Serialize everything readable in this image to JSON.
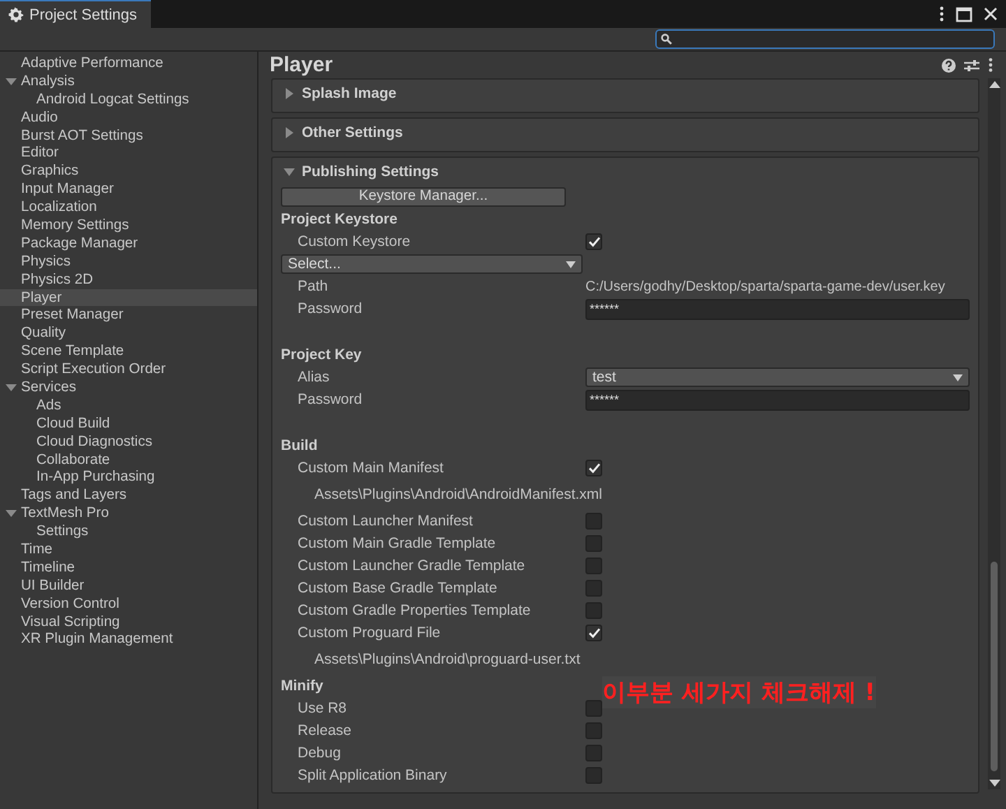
{
  "window": {
    "title": "Project Settings"
  },
  "sidebar": {
    "items": [
      {
        "label": "Adaptive Performance",
        "selected": false
      },
      {
        "label": "Analysis",
        "selected": false,
        "expanded": true,
        "children": [
          {
            "label": "Android Logcat Settings",
            "selected": false
          }
        ]
      },
      {
        "label": "Audio",
        "selected": false
      },
      {
        "label": "Burst AOT Settings",
        "selected": false
      },
      {
        "label": "Editor",
        "selected": false
      },
      {
        "label": "Graphics",
        "selected": false
      },
      {
        "label": "Input Manager",
        "selected": false
      },
      {
        "label": "Localization",
        "selected": false
      },
      {
        "label": "Memory Settings",
        "selected": false
      },
      {
        "label": "Package Manager",
        "selected": false
      },
      {
        "label": "Physics",
        "selected": false
      },
      {
        "label": "Physics 2D",
        "selected": false
      },
      {
        "label": "Player",
        "selected": true
      },
      {
        "label": "Preset Manager",
        "selected": false
      },
      {
        "label": "Quality",
        "selected": false
      },
      {
        "label": "Scene Template",
        "selected": false
      },
      {
        "label": "Script Execution Order",
        "selected": false
      },
      {
        "label": "Services",
        "selected": false,
        "expanded": true,
        "children": [
          {
            "label": "Ads",
            "selected": false
          },
          {
            "label": "Cloud Build",
            "selected": false
          },
          {
            "label": "Cloud Diagnostics",
            "selected": false
          },
          {
            "label": "Collaborate",
            "selected": false
          },
          {
            "label": "In-App Purchasing",
            "selected": false
          }
        ]
      },
      {
        "label": "Tags and Layers",
        "selected": false
      },
      {
        "label": "TextMesh Pro",
        "selected": false,
        "expanded": true,
        "children": [
          {
            "label": "Settings",
            "selected": false
          }
        ]
      },
      {
        "label": "Time",
        "selected": false
      },
      {
        "label": "Timeline",
        "selected": false
      },
      {
        "label": "UI Builder",
        "selected": false
      },
      {
        "label": "Version Control",
        "selected": false
      },
      {
        "label": "Visual Scripting",
        "selected": false
      },
      {
        "label": "XR Plugin Management",
        "selected": false
      }
    ]
  },
  "inspector": {
    "title": "Player",
    "sections": [
      {
        "title": "Splash Image",
        "expanded": false
      },
      {
        "title": "Other Settings",
        "expanded": false
      },
      {
        "title": "Publishing Settings",
        "expanded": true,
        "groups": [
          {
            "rows": [
              {
                "kind": "button",
                "label": "Keystore Manager..."
              },
              {
                "kind": "heading",
                "label": "Project Keystore"
              },
              {
                "kind": "checkbox",
                "label": "Custom Keystore",
                "checked": true
              },
              {
                "kind": "dropdown",
                "value": "Select..."
              },
              {
                "kind": "text",
                "label": "Path",
                "value": "C:/Users/godhy/Desktop/sparta/sparta-game-dev/user.key"
              },
              {
                "kind": "password",
                "label": "Password",
                "value": "******"
              }
            ]
          },
          {
            "rows": [
              {
                "kind": "heading",
                "label": "Project Key"
              },
              {
                "kind": "select",
                "label": "Alias",
                "value": "test"
              },
              {
                "kind": "password",
                "label": "Password",
                "value": "******"
              }
            ]
          },
          {
            "rows": [
              {
                "kind": "heading",
                "label": "Build"
              },
              {
                "kind": "checkbox",
                "label": "Custom Main Manifest",
                "checked": true
              },
              {
                "kind": "file",
                "value": "Assets\\Plugins\\Android\\AndroidManifest.xml"
              },
              {
                "kind": "checkbox",
                "label": "Custom Launcher Manifest",
                "checked": false
              },
              {
                "kind": "checkbox",
                "label": "Custom Main Gradle Template",
                "checked": false
              },
              {
                "kind": "checkbox",
                "label": "Custom Launcher Gradle Template",
                "checked": false
              },
              {
                "kind": "checkbox",
                "label": "Custom Base Gradle Template",
                "checked": false
              },
              {
                "kind": "checkbox",
                "label": "Custom Gradle Properties Template",
                "checked": false
              },
              {
                "kind": "checkbox",
                "label": "Custom Proguard File",
                "checked": true
              },
              {
                "kind": "file",
                "value": "Assets\\Plugins\\Android\\proguard-user.txt"
              },
              {
                "kind": "heading",
                "label": "Minify"
              },
              {
                "kind": "checkbox",
                "label": "Use R8",
                "checked": false
              },
              {
                "kind": "checkbox",
                "label": "Release",
                "checked": false
              },
              {
                "kind": "checkbox",
                "label": "Debug",
                "checked": false
              },
              {
                "kind": "checkbox",
                "label": "Split Application Binary",
                "checked": false
              }
            ]
          }
        ]
      }
    ]
  },
  "annotation": {
    "text": "이부분 세가지 체크해제 !"
  }
}
